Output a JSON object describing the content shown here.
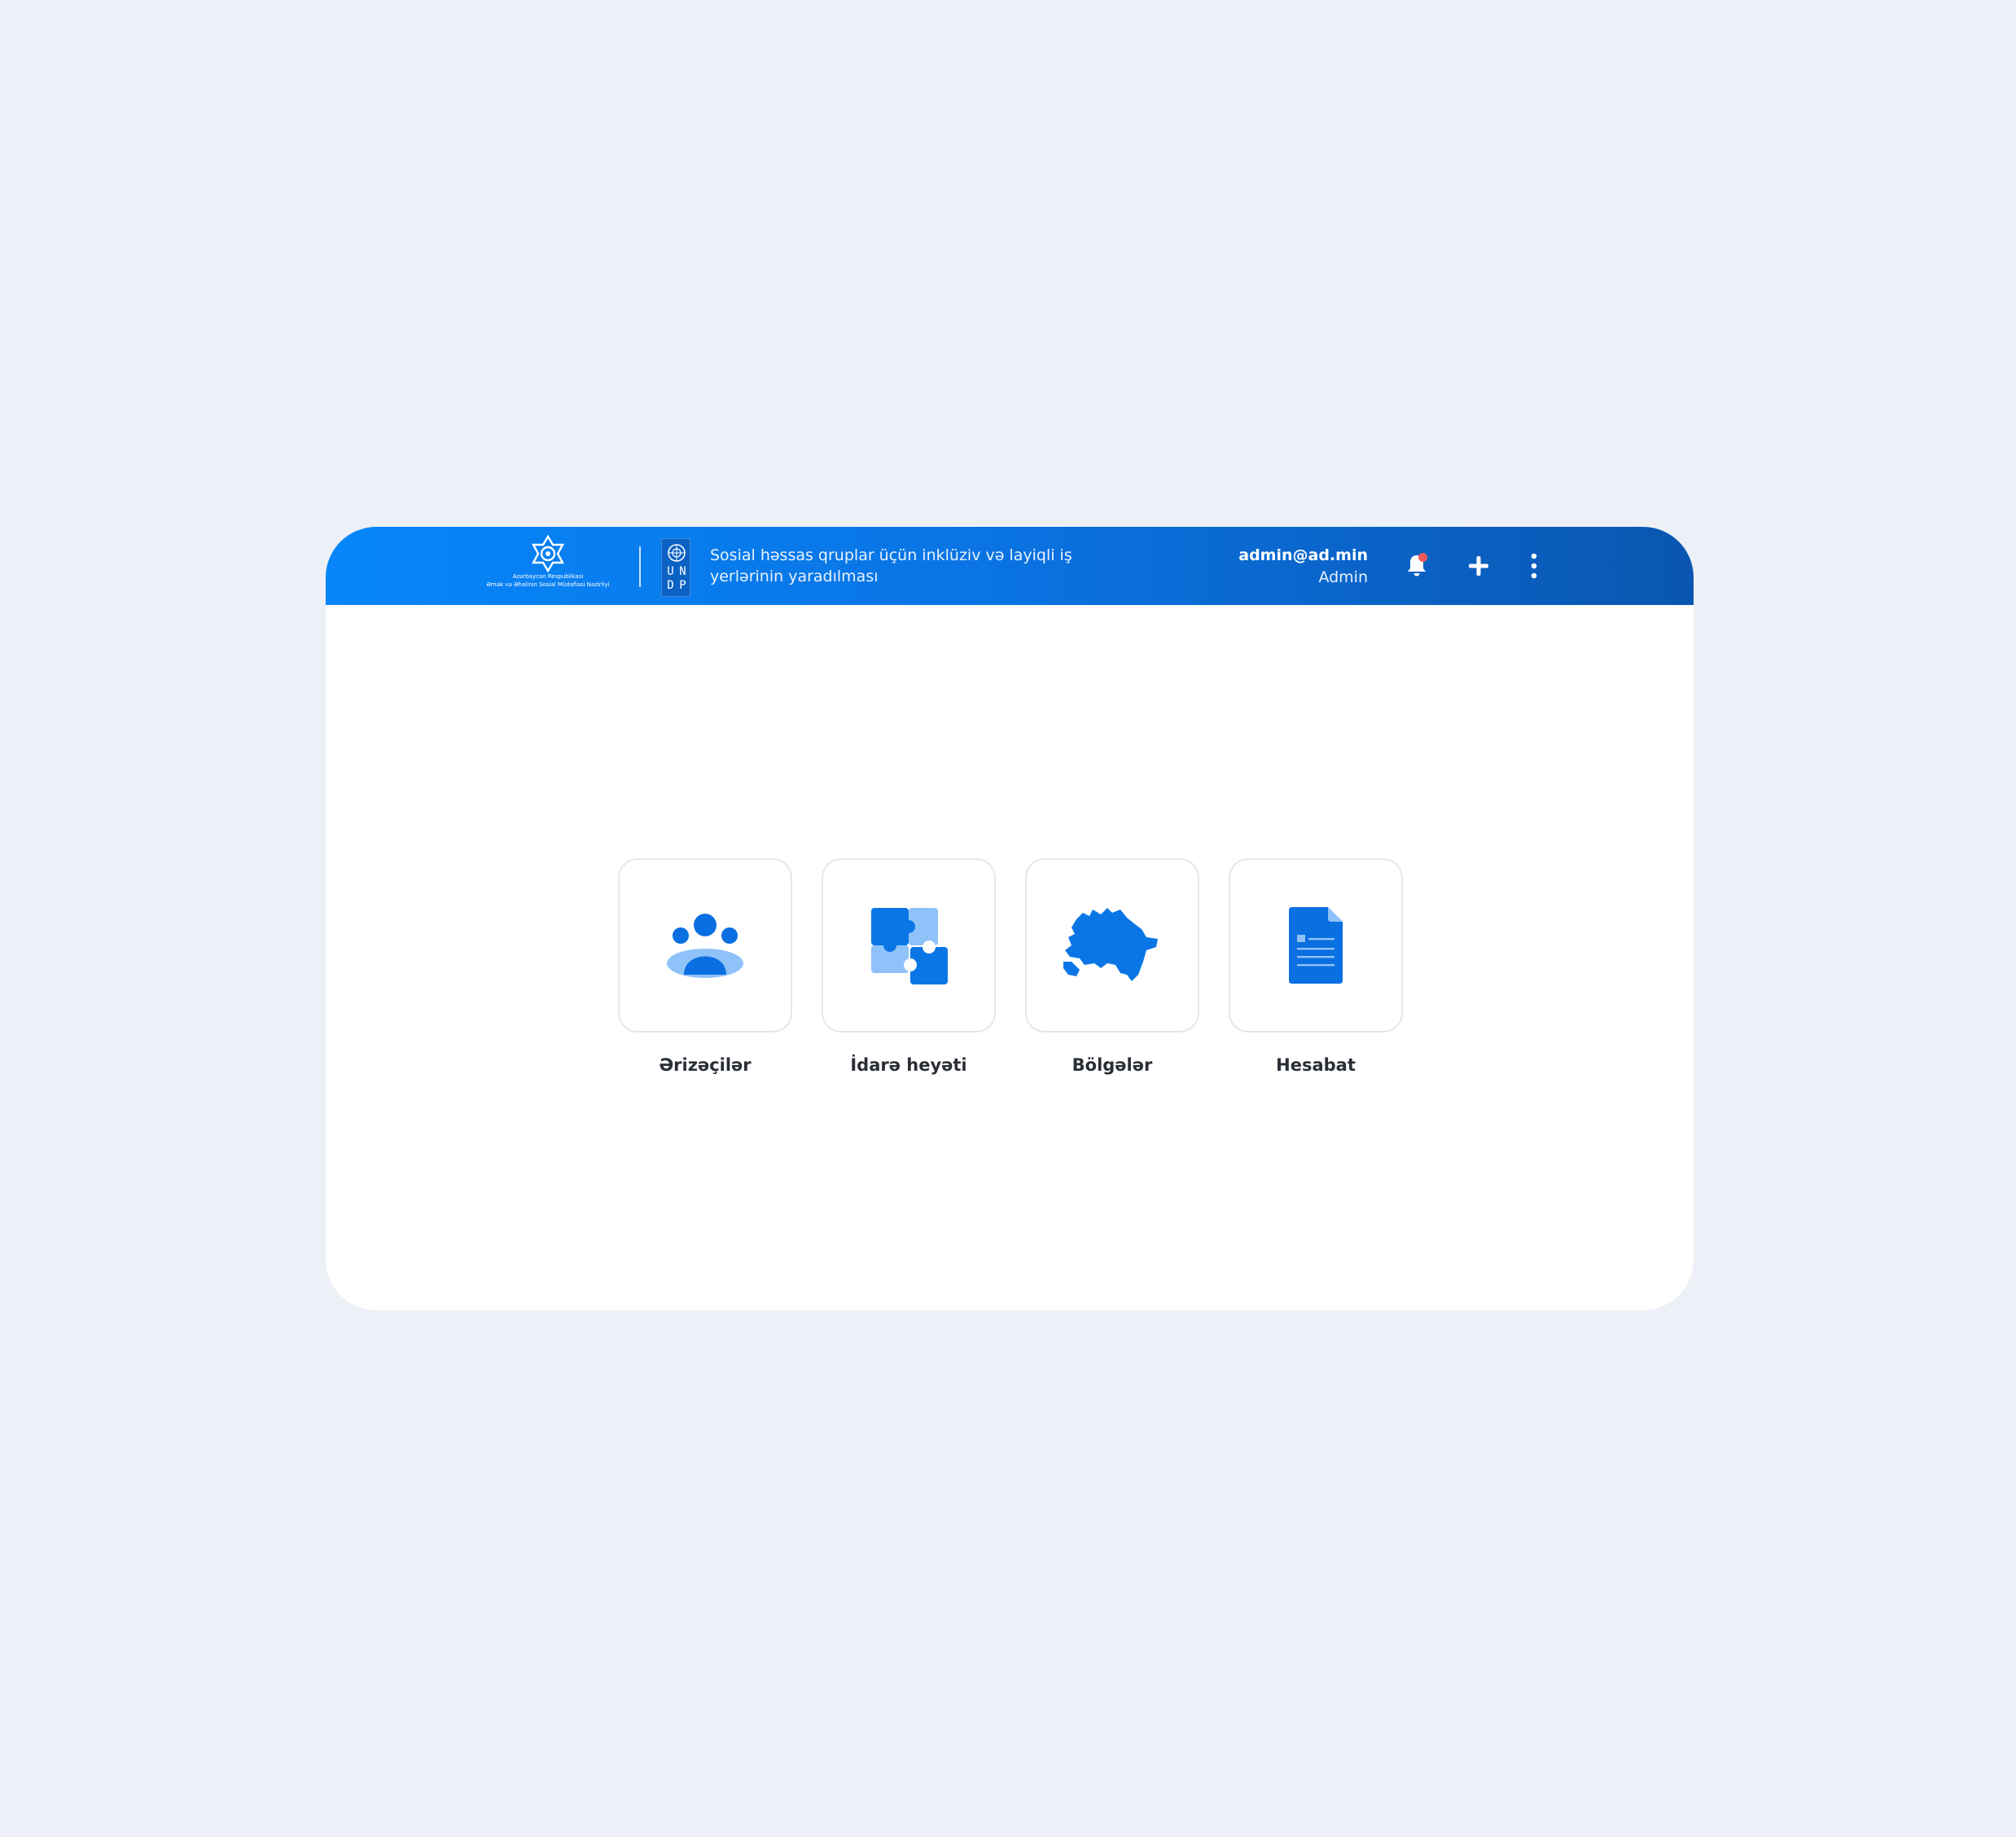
{
  "header": {
    "ministry_logo_text_line1": "Azərbaycan Respublikası",
    "ministry_logo_text_line2": "Əmək və Əhalinin Sosial Müdafiəsi Nazirliyi",
    "undp_letters": [
      "U",
      "N",
      "D",
      "P"
    ],
    "project_title": "Sosial həssas qruplar üçün inklüziv və layiqli iş yerlərinin yaradılması",
    "user_email": "admin@ad.min",
    "user_role": "Admin",
    "icons": {
      "bell": "bell-icon",
      "plus": "plus-icon",
      "more": "more-vertical-icon"
    }
  },
  "tiles": [
    {
      "label": "Ərizəçilər",
      "icon": "users-group-icon"
    },
    {
      "label": "İdarə heyəti",
      "icon": "puzzle-icon"
    },
    {
      "label": "Bölgələr",
      "icon": "azerbaijan-map-icon"
    },
    {
      "label": "Hesabat",
      "icon": "document-icon"
    }
  ],
  "colors": {
    "page_background": "#edf0f6",
    "header_gradient_start": "#0686fa",
    "header_gradient_end": "#0a56b0",
    "accent_blue": "#0a76e6",
    "accent_light_blue": "#8fc2f8",
    "notification_dot": "#f25a5a",
    "tile_border": "#e4e7ec",
    "label_text": "#2a2f36"
  }
}
